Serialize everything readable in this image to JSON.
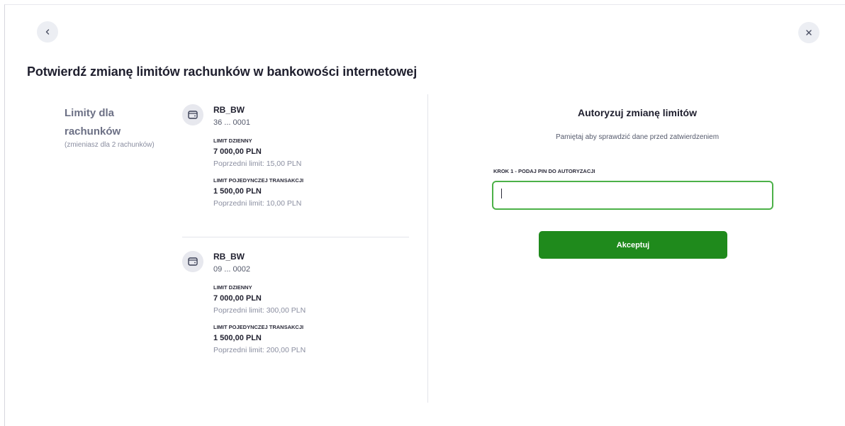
{
  "header": {
    "title": "Potwierdź zmianę limitów rachunków w bankowości internetowej",
    "back_icon": "chevron-left-icon",
    "close_icon": "close-icon"
  },
  "summary": {
    "label": "Limity dla rachunków",
    "sublabel": "(zmieniasz dla 2 rachunków)"
  },
  "accounts": [
    {
      "icon": "wallet-icon",
      "name": "RB_BW",
      "number": "36 ... 0001",
      "limits": [
        {
          "title": "LIMIT DZIENNY",
          "value": "7 000,00 PLN",
          "previous": "Poprzedni limit: 15,00 PLN"
        },
        {
          "title": "LIMIT POJEDYNCZEJ TRANSAKCJI",
          "value": "1 500,00 PLN",
          "previous": "Poprzedni limit: 10,00 PLN"
        }
      ]
    },
    {
      "icon": "wallet-icon",
      "name": "RB_BW",
      "number": "09 ... 0002",
      "limits": [
        {
          "title": "LIMIT DZIENNY",
          "value": "7 000,00 PLN",
          "previous": "Poprzedni limit: 300,00 PLN"
        },
        {
          "title": "LIMIT POJEDYNCZEJ TRANSAKCJI",
          "value": "1 500,00 PLN",
          "previous": "Poprzedni limit: 200,00 PLN"
        }
      ]
    }
  ],
  "auth": {
    "title": "Autoryzuj zmianę limitów",
    "subtitle": "Pamiętaj aby sprawdzić dane przed zatwierdzeniem",
    "step_label": "KROK 1 - PODAJ PIN DO AUTORYZACJI",
    "pin_value": "",
    "accept_label": "Akceptuj"
  },
  "colors": {
    "accent": "#1f8a1c",
    "input_border": "#4cb148"
  }
}
